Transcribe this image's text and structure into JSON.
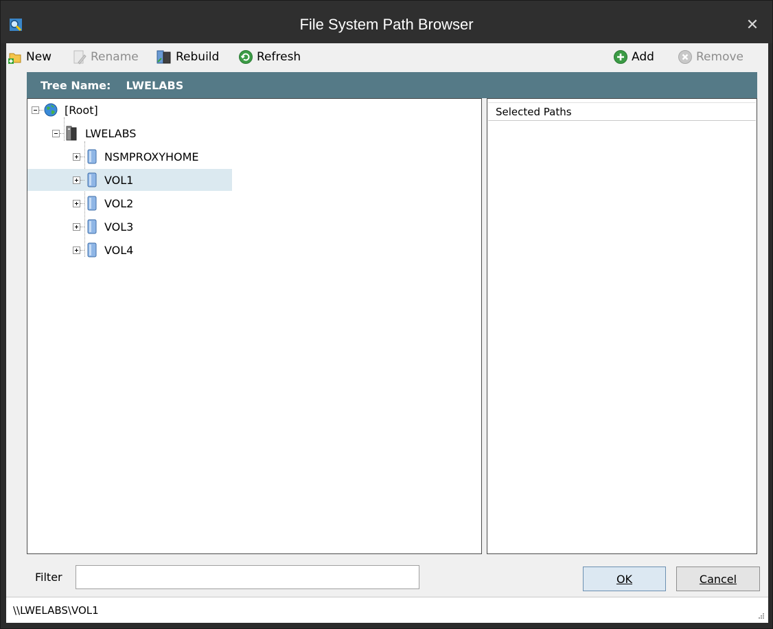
{
  "window": {
    "title": "File System Path Browser"
  },
  "toolbar": {
    "new_label": "New",
    "rename_label": "Rename",
    "rebuild_label": "Rebuild",
    "refresh_label": "Refresh",
    "add_label": "Add",
    "remove_label": "Remove"
  },
  "tree_header": {
    "label": "Tree Name:",
    "value": "LWELABS"
  },
  "tree": {
    "root_label": "[Root]",
    "server_label": "LWELABS",
    "volumes": [
      "NSMPROXYHOME",
      "VOL1",
      "VOL2",
      "VOL3",
      "VOL4"
    ],
    "selected": "VOL1"
  },
  "paths_pane": {
    "header": "Selected Paths"
  },
  "filter": {
    "label": "Filter",
    "value": ""
  },
  "buttons": {
    "ok_label": "OK",
    "cancel_label": "Cancel"
  },
  "status": {
    "path": "\\\\LWELABS\\VOL1"
  },
  "colors": {
    "header_bg": "#557a87",
    "selection_bg": "#dbe9f0",
    "titlebar_bg": "#2f2f2f"
  }
}
